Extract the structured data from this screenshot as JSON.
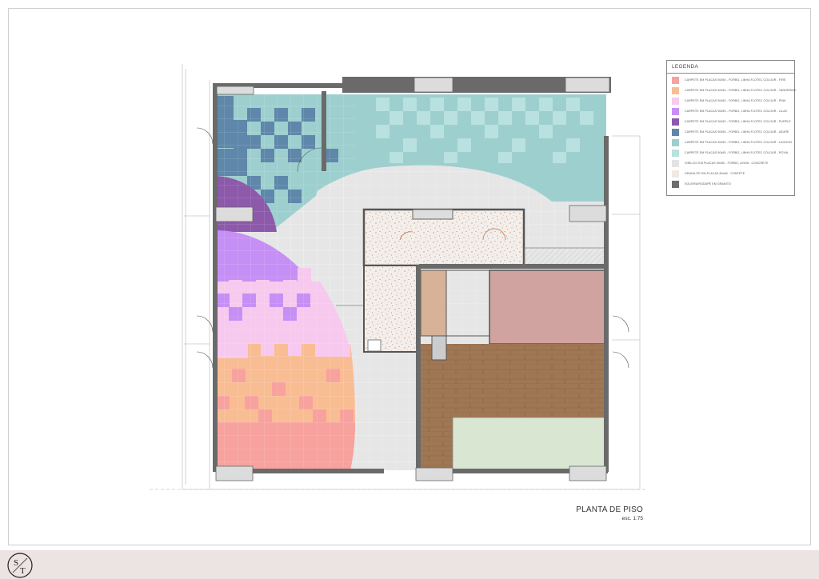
{
  "legend": {
    "title": "LEGENDA",
    "items": [
      {
        "color": "#f7a29e",
        "text": "CARPETE EM PLACAS 50x50 - FORBO, LINHA FLOTEC COLOUR - FIRE"
      },
      {
        "color": "#f9bd94",
        "text": "CARPETE EM PLACAS 50x50 - FORBO, LINHA FLOTEC COLOUR - TANGERINE"
      },
      {
        "color": "#f7c9ee",
        "text": "CARPETE EM PLACAS 50x50 - FORBO, LINHA FLOTEC COLOUR - PINK"
      },
      {
        "color": "#c68ff5",
        "text": "CARPETE EM PLACAS 50x50 - FORBO, LINHA FLOTEC COLOUR - LILAC"
      },
      {
        "color": "#8d59aa",
        "text": "CARPETE EM PLACAS 50x50 - FORBO, LINHA FLOTEC COLOUR - PURPLE"
      },
      {
        "color": "#5f87aa",
        "text": "CARPETE EM PLACAS 50x50 - FORBO, LINHA FLOTEC COLOUR - AZURE"
      },
      {
        "color": "#9ecfcf",
        "text": "CARPETE EM PLACAS 50x50 - FORBO, LINHA FLOTEC COLOUR - LAGOON"
      },
      {
        "color": "#b9e1df",
        "text": "CARPETE EM PLACAS 50x50 - FORBO, LINHA FLOTEC COLOUR - ROYAL"
      },
      {
        "color": "#e4e4e4",
        "text": "VINÍLICO EM PLACAS 50x50 - FORBO, LINHA - CONCRETE"
      },
      {
        "color": "#efe9e4",
        "text": "GRANILITE EM PLACAS 80x80 - CONFETE"
      },
      {
        "color": "#6d6d6d",
        "text": "SOLEIRA/RODAPÉ EM GRANITO"
      }
    ]
  },
  "plan": {
    "title": "PLANTA DE PISO",
    "scale": "esc. 1:75"
  },
  "logo": {
    "text": "ST"
  }
}
